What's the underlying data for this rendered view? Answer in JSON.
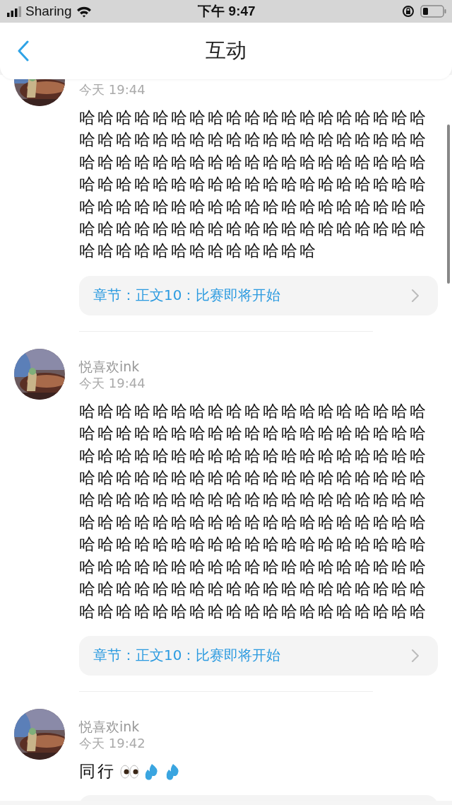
{
  "status_bar": {
    "carrier": "Sharing",
    "time": "下午 9:47"
  },
  "header": {
    "title": "互动"
  },
  "posts": [
    {
      "time": "今天 19:44",
      "text": "哈哈哈哈哈哈哈哈哈哈哈哈哈哈哈哈哈哈哈哈哈哈哈哈哈哈哈哈哈哈哈哈哈哈哈哈哈哈哈哈哈哈哈哈哈哈哈哈哈哈哈哈哈哈哈哈哈哈哈哈哈哈哈哈哈哈哈哈哈哈哈哈哈哈哈哈哈哈哈哈哈哈哈哈哈哈哈哈哈哈哈哈哈哈哈哈哈哈哈哈哈哈哈哈哈哈哈哈哈哈哈哈哈哈哈哈哈哈哈哈哈哈哈哈哈哈哈",
      "chapter": {
        "text": "章节：正文10：比赛即将开始"
      }
    },
    {
      "name": "悦喜欢ink",
      "time": "今天 19:44",
      "text": "哈哈哈哈哈哈哈哈哈哈哈哈哈哈哈哈哈哈哈哈哈哈哈哈哈哈哈哈哈哈哈哈哈哈哈哈哈哈哈哈哈哈哈哈哈哈哈哈哈哈哈哈哈哈哈哈哈哈哈哈哈哈哈哈哈哈哈哈哈哈哈哈哈哈哈哈哈哈哈哈哈哈哈哈哈哈哈哈哈哈哈哈哈哈哈哈哈哈哈哈哈哈哈哈哈哈哈哈哈哈哈哈哈哈哈哈哈哈哈哈哈哈哈哈哈哈哈哈哈哈哈哈哈哈哈哈哈哈哈哈哈哈哈哈哈哈哈哈哈哈哈哈哈哈哈哈哈哈哈哈哈哈哈哈哈哈哈哈哈哈哈哈哈哈哈哈哈哈哈哈哈哈哈哈哈哈哈哈哈哈",
      "chapter": {
        "text": "章节：正文10：比赛即将开始"
      }
    },
    {
      "name": "悦喜欢ink",
      "time": "今天 19:42",
      "text": "同行",
      "emoji": [
        {
          "kind": "eyes"
        },
        {
          "kind": "droplets"
        },
        {
          "kind": "droplets"
        }
      ],
      "chapter": {
        "cut_off": true
      }
    }
  ]
}
